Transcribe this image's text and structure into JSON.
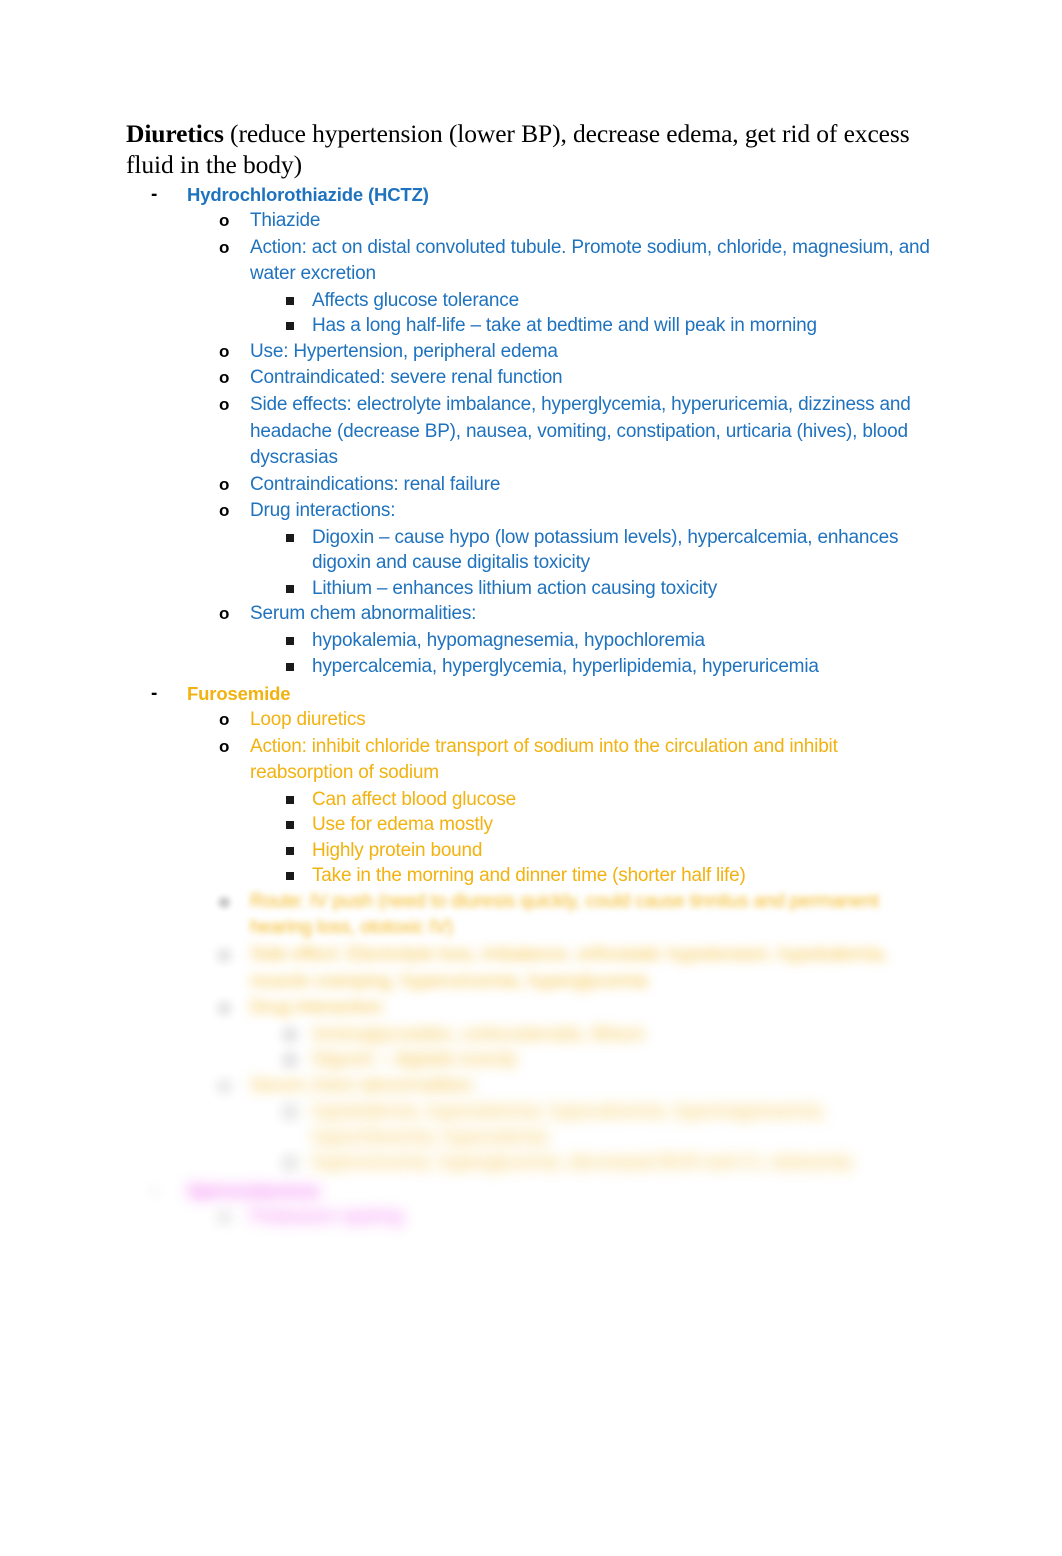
{
  "document": {
    "title_lead": "Diuretics",
    "title_rest": " (reduce hypertension (lower BP), decrease edema, get rid of excess fluid in the body)"
  },
  "colors": {
    "hctz_blue": "#1F72BE",
    "furosemide_gold": "#F2B20F",
    "third_drug_pink": "#EE45EE",
    "marker_black": "#000000",
    "page_background": "#FFFFFF"
  },
  "markers": {
    "level1": "-",
    "level2": "o",
    "level3": "square-bullet"
  },
  "outline": [
    {
      "level": 1,
      "color": "blue",
      "text": "Hydrochlorothiazide (HCTZ)",
      "blur": 0
    },
    {
      "level": 2,
      "color": "blue",
      "text": "Thiazide",
      "blur": 0
    },
    {
      "level": 2,
      "color": "blue",
      "text": "Action: act on distal convoluted tubule. Promote sodium, chloride, magnesium, and water excretion",
      "blur": 0
    },
    {
      "level": 3,
      "color": "blue",
      "text": "Affects glucose tolerance",
      "blur": 0
    },
    {
      "level": 3,
      "color": "blue",
      "text": "Has a long half-life – take at bedtime and will peak in morning",
      "blur": 0
    },
    {
      "level": 2,
      "color": "blue",
      "text": "Use: Hypertension, peripheral edema",
      "blur": 0
    },
    {
      "level": 2,
      "color": "blue",
      "text": "Contraindicated: severe renal function",
      "blur": 0
    },
    {
      "level": 2,
      "color": "blue",
      "text": "Side effects: electrolyte imbalance, hyperglycemia, hyperuricemia, dizziness and headache (decrease BP), nausea, vomiting, constipation, urticaria (hives), blood dyscrasias",
      "blur": 0
    },
    {
      "level": 2,
      "color": "blue",
      "text": "Contraindications: renal failure",
      "blur": 0
    },
    {
      "level": 2,
      "color": "blue",
      "text": "Drug interactions:",
      "blur": 0
    },
    {
      "level": 3,
      "color": "blue",
      "text": "Digoxin – cause hypo (low potassium levels), hypercalcemia, enhances digoxin and cause digitalis toxicity",
      "blur": 0
    },
    {
      "level": 3,
      "color": "blue",
      "text": "Lithium – enhances lithium action causing toxicity",
      "blur": 0
    },
    {
      "level": 2,
      "color": "blue",
      "text": "Serum chem abnormalities:",
      "blur": 0
    },
    {
      "level": 3,
      "color": "blue",
      "text": "hypokalemia, hypomagnesemia, hypochloremia",
      "blur": 0
    },
    {
      "level": 3,
      "color": "blue",
      "text": "hypercalcemia, hyperglycemia, hyperlipidemia, hyperuricemia",
      "blur": 0
    },
    {
      "level": 1,
      "color": "gold",
      "text": "Furosemide",
      "blur": 0
    },
    {
      "level": 2,
      "color": "gold",
      "text": "Loop diuretics",
      "blur": 0
    },
    {
      "level": 2,
      "color": "gold",
      "text": "Action: inhibit chloride transport of sodium into the circulation and inhibit reabsorption of sodium",
      "blur": 0
    },
    {
      "level": 3,
      "color": "gold",
      "text": "Can affect blood glucose",
      "blur": 0
    },
    {
      "level": 3,
      "color": "gold",
      "text": "Use for edema mostly",
      "blur": 0
    },
    {
      "level": 3,
      "color": "gold",
      "text": "Highly protein bound",
      "blur": 0
    },
    {
      "level": 3,
      "color": "gold",
      "text": "Take in the morning and dinner time (shorter half life)",
      "blur": 0
    },
    {
      "level": 2,
      "color": "gold",
      "text": "Route: IV push (need to diuresis quickly, could cause tinnitus and permanent hearing loss, ototoxic IV)",
      "blur": 1
    },
    {
      "level": 2,
      "color": "gold",
      "text": "Side effect: Electrolyte loss, imbalance, orthostatic hypotension, hypokalemia, muscle cramping, hyperuricemia, hyperglycemia",
      "blur": 3
    },
    {
      "level": 2,
      "color": "gold",
      "text": "Drug interaction:",
      "blur": 3
    },
    {
      "level": 3,
      "color": "gold",
      "text": "Aminoglycosides, corticosteroids, lithium",
      "blur": 4
    },
    {
      "level": 3,
      "color": "gold",
      "text": "Digoxin – digitalis toxicity",
      "blur": 4
    },
    {
      "level": 2,
      "color": "gold",
      "text": "Serum chem abnormalities:",
      "blur": 4
    },
    {
      "level": 3,
      "color": "gold",
      "text": "hypokalemia, hyponatremia, hypocalcemia, hypomagnesemia, hypochloremia, hypovolemia",
      "blur": 5
    },
    {
      "level": 3,
      "color": "gold",
      "text": "hyperuricemia, hyperglycemia, decreased BUN and Cr, ototoxicity",
      "blur": 5
    },
    {
      "level": 1,
      "color": "pink",
      "text": "Spironolactone",
      "blur": 5
    },
    {
      "level": 2,
      "color": "pink",
      "text": "Potassium sparing",
      "blur": 5
    }
  ]
}
